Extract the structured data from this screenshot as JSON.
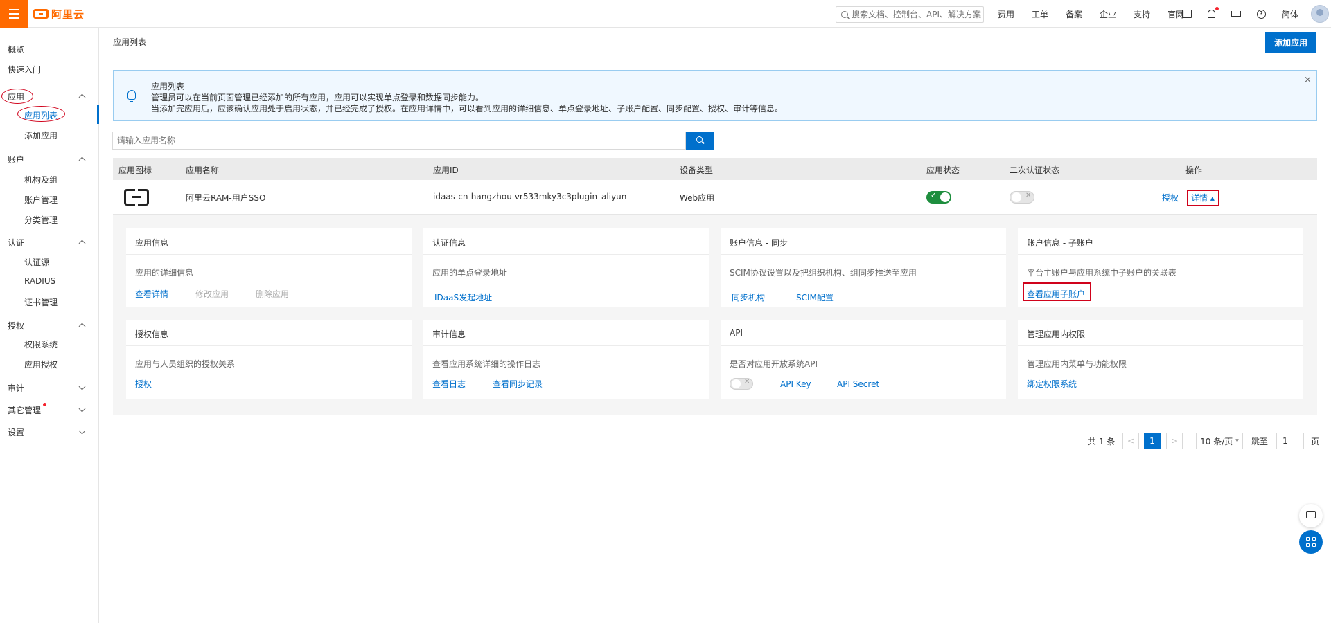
{
  "topbar": {
    "brand": "阿里云",
    "search_placeholder": "搜索文档、控制台、API、解决方案",
    "links": [
      "费用",
      "工单",
      "备案",
      "企业",
      "支持",
      "官网"
    ],
    "lang": "简体"
  },
  "sidebar": {
    "overview": "概览",
    "quickstart": "快速入门",
    "app_group": "应用",
    "app_list": "应用列表",
    "app_add": "添加应用",
    "account_group": "账户",
    "org": "机构及组",
    "account_mgmt": "账户管理",
    "category_mgmt": "分类管理",
    "auth_group": "认证",
    "auth_source": "认证源",
    "radius": "RADIUS",
    "cert_mgmt": "证书管理",
    "authz_group": "授权",
    "perm_system": "权限系统",
    "app_authz": "应用授权",
    "audit_group": "审计",
    "other_group": "其它管理",
    "settings_group": "设置"
  },
  "header": {
    "title": "应用列表",
    "add_button": "添加应用"
  },
  "notice": {
    "title": "应用列表",
    "line1": "管理员可以在当前页面管理已经添加的所有应用，应用可以实现单点登录和数据同步能力。",
    "line2": "当添加完应用后，应该确认应用处于启用状态，并已经完成了授权。在应用详情中，可以看到应用的详细信息、单点登录地址、子账户配置、同步配置、授权、审计等信息。",
    "close": "×"
  },
  "filter": {
    "placeholder": "请输入应用名称"
  },
  "table": {
    "headers": [
      "应用图标",
      "应用名称",
      "应用ID",
      "设备类型",
      "应用状态",
      "二次认证状态",
      "操作"
    ],
    "row": {
      "name": "阿里云RAM-用户SSO",
      "id": "idaas-cn-hangzhou-vr533mky3c3plugin_aliyun",
      "device": "Web应用",
      "status_on": true,
      "mfa_on": false,
      "action_authorize": "授权",
      "action_detail": "详情 ▴"
    }
  },
  "cards": [
    {
      "title": "应用信息",
      "desc": "应用的详细信息",
      "links": [
        "查看详情",
        "修改应用",
        "删除应用"
      ]
    },
    {
      "title": "认证信息",
      "desc": "应用的单点登录地址",
      "links": [
        "IDaaS发起地址"
      ]
    },
    {
      "title": "账户信息 - 同步",
      "desc": "SCIM协议设置以及把组织机构、组同步推送至应用",
      "links": [
        "同步机构",
        "SCIM配置"
      ]
    },
    {
      "title": "账户信息 - 子账户",
      "desc": "平台主账户与应用系统中子账户的关联表",
      "links": [
        "查看应用子账户"
      ]
    },
    {
      "title": "授权信息",
      "desc": "应用与人员组织的授权关系",
      "links": [
        "授权"
      ]
    },
    {
      "title": "审计信息",
      "desc": "查看应用系统详细的操作日志",
      "links": [
        "查看日志",
        "查看同步记录"
      ]
    },
    {
      "title": "API",
      "desc": "是否对应用开放系统API",
      "links": [
        "API Key",
        "API Secret"
      ]
    },
    {
      "title": "管理应用内权限",
      "desc": "管理应用内菜单与功能权限",
      "links": [
        "绑定权限系统"
      ]
    }
  ],
  "pagination": {
    "total": "共 1 条",
    "prev": "<",
    "current": "1",
    "next": ">",
    "page_size": "10 条/页",
    "jump_label": "跳至",
    "jump_value": "1",
    "page_unit": "页"
  },
  "colors": {
    "brand": "#ff6a00",
    "primary": "#0070cc",
    "highlight": "#d0021b",
    "toggle_on": "#1e8e3e"
  }
}
